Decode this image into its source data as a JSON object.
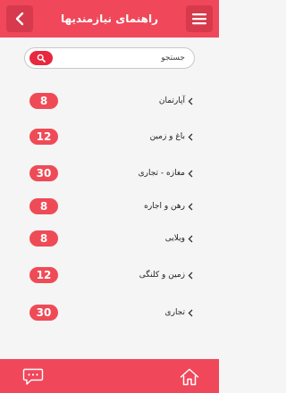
{
  "header": {
    "title": "راهنمای نیازمندیها",
    "menu_icon": "hamburger-menu-icon",
    "back_icon": "chevron-left-icon"
  },
  "search": {
    "placeholder": "جستجو",
    "button_icon": "search-icon"
  },
  "categories": [
    {
      "label": "آپارتمان",
      "count": "8"
    },
    {
      "label": "باغ و زمین",
      "count": "12"
    },
    {
      "label": "مغازه - تجاری",
      "count": "30"
    },
    {
      "label": "رهن و اجاره",
      "count": "8"
    },
    {
      "label": "ویلایی",
      "count": "8"
    },
    {
      "label": "زمین و کلنگی",
      "count": "12"
    },
    {
      "label": "تجاری",
      "count": "30"
    }
  ],
  "footer": {
    "chat_icon": "chat-bubble-icon",
    "home_icon": "home-icon"
  },
  "colors": {
    "primary": "#f0475a",
    "badge": "#ef4b57",
    "background": "#f5f5f5"
  }
}
